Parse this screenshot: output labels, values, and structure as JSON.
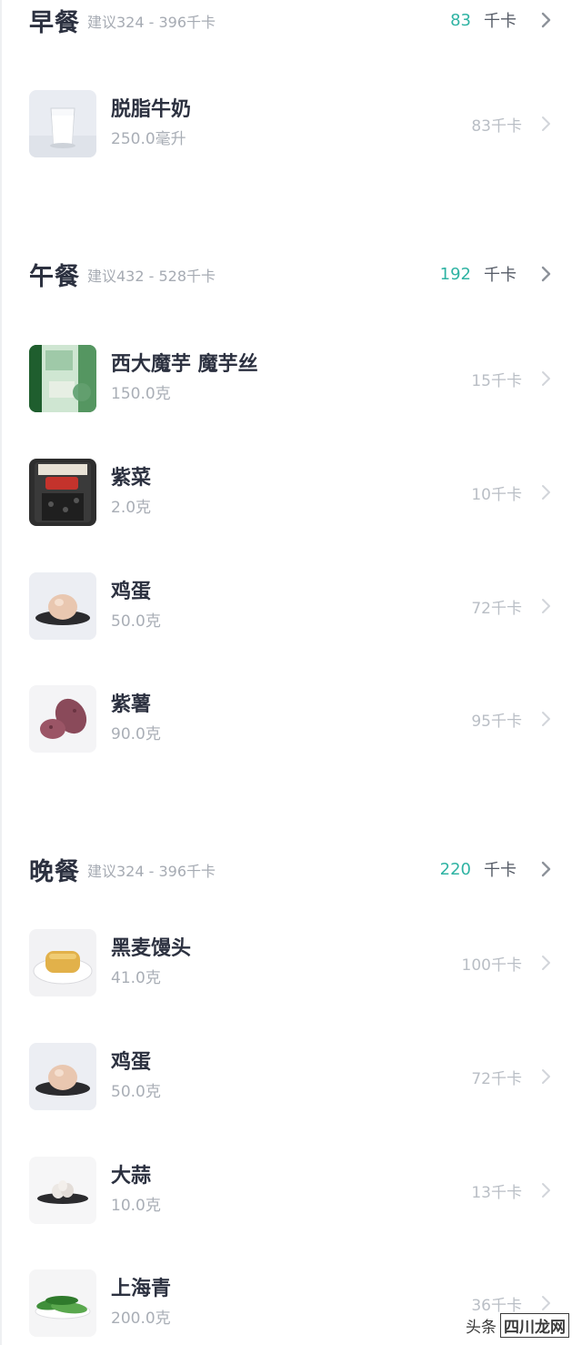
{
  "meals": [
    {
      "title": "早餐",
      "suggest": "建议324 - 396千卡",
      "kcal": "83",
      "unit": "千卡",
      "items": [
        {
          "name": "脱脂牛奶",
          "amount": "250.0毫升",
          "kcal": "83千卡",
          "icon": "milk-glass-icon"
        }
      ]
    },
    {
      "title": "午餐",
      "suggest": "建议432 - 528千卡",
      "kcal": "192",
      "unit": "千卡",
      "items": [
        {
          "name": "西大魔芋 魔芋丝",
          "amount": "150.0克",
          "kcal": "15千卡",
          "icon": "konjac-package-icon"
        },
        {
          "name": "紫菜",
          "amount": "2.0克",
          "kcal": "10千卡",
          "icon": "seaweed-package-icon"
        },
        {
          "name": "鸡蛋",
          "amount": "50.0克",
          "kcal": "72千卡",
          "icon": "egg-plate-icon"
        },
        {
          "name": "紫薯",
          "amount": "90.0克",
          "kcal": "95千卡",
          "icon": "purple-sweet-potato-icon"
        }
      ]
    },
    {
      "title": "晚餐",
      "suggest": "建议324 - 396千卡",
      "kcal": "220",
      "unit": "千卡",
      "items": [
        {
          "name": "黑麦馒头",
          "amount": "41.0克",
          "kcal": "100千卡",
          "icon": "rye-bun-plate-icon"
        },
        {
          "name": "鸡蛋",
          "amount": "50.0克",
          "kcal": "72千卡",
          "icon": "egg-plate-icon"
        },
        {
          "name": "大蒜",
          "amount": "10.0克",
          "kcal": "13千卡",
          "icon": "garlic-plate-icon"
        },
        {
          "name": "上海青",
          "amount": "200.0克",
          "kcal": "36千卡",
          "icon": "bok-choy-plate-icon"
        }
      ]
    }
  ],
  "watermark": {
    "source": "头条",
    "site": "四川龙网"
  },
  "colors": {
    "accent": "#2fb3a3",
    "title": "#2c3140",
    "muted": "#a9aeb6"
  }
}
